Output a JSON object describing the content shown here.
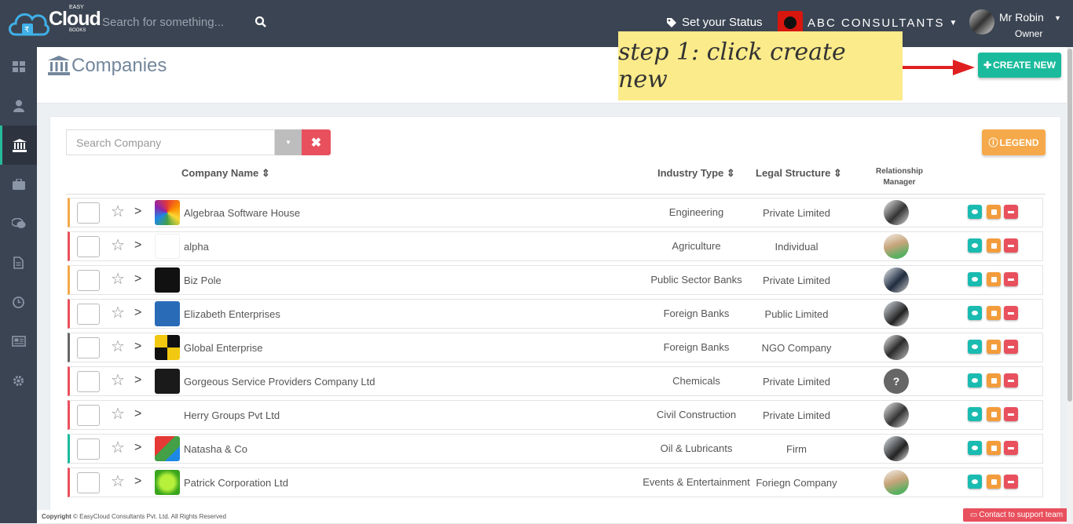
{
  "brand": {
    "name": "Cloud",
    "top": "EASY",
    "bottom": "BOOKS"
  },
  "topbar": {
    "search_placeholder": "Search for something...",
    "status_label": "Set your Status",
    "company_name": "ABC CONSULTANTS",
    "user_name": "Mr Robin",
    "user_role": "Owner"
  },
  "sidebar": {
    "items": [
      {
        "icon": "dashboard-icon",
        "active": false
      },
      {
        "icon": "user-icon",
        "active": false
      },
      {
        "icon": "bank-icon",
        "active": true
      },
      {
        "icon": "briefcase-icon",
        "active": false
      },
      {
        "icon": "chat-icon",
        "active": false
      },
      {
        "icon": "document-icon",
        "active": false
      },
      {
        "icon": "clock-icon",
        "active": false
      },
      {
        "icon": "newspaper-icon",
        "active": false
      },
      {
        "icon": "gear-icon",
        "active": false
      }
    ]
  },
  "page": {
    "title": "Companies",
    "create_label": "CREATE NEW",
    "annotation": "step 1: click create new"
  },
  "filters": {
    "search_placeholder": "Search Company",
    "legend_label": "LEGEND"
  },
  "table": {
    "headers": {
      "company": "Company Name",
      "industry": "Industry Type",
      "legal": "Legal Structure",
      "manager_line1": "Relationship",
      "manager_line2": "Manager"
    },
    "rows": [
      {
        "name": "Algebraa Software House",
        "industry": "Engineering",
        "legal": "Private Limited",
        "stripe": "#f5a94a",
        "manager": "photo-a"
      },
      {
        "name": "alpha",
        "industry": "Agriculture",
        "legal": "Individual",
        "stripe": "#e9505d",
        "manager": "photo-b"
      },
      {
        "name": "Biz Pole",
        "industry": "Public Sector Banks",
        "legal": "Private Limited",
        "stripe": "#f5a94a",
        "manager": "photo-c"
      },
      {
        "name": "Elizabeth Enterprises",
        "industry": "Foreign Banks",
        "legal": "Public Limited",
        "stripe": "#e9505d",
        "manager": "photo-d"
      },
      {
        "name": "Global Enterprise",
        "industry": "Foreign Banks",
        "legal": "NGO Company",
        "stripe": "#666666",
        "manager": "photo-e"
      },
      {
        "name": "Gorgeous Service Providers Company Ltd",
        "industry": "Chemicals",
        "legal": "Private Limited",
        "stripe": "#e9505d",
        "manager": "unknown"
      },
      {
        "name": "Herry Groups Pvt Ltd",
        "industry": "Civil Construction",
        "legal": "Private Limited",
        "stripe": "#e9505d",
        "manager": "photo-a"
      },
      {
        "name": "Natasha & Co",
        "industry": "Oil & Lubricants",
        "legal": "Firm",
        "stripe": "#1abb9c",
        "manager": "photo-d"
      },
      {
        "name": "Patrick Corporation Ltd",
        "industry": "Events & Entertainment",
        "legal": "Foriegn Company",
        "stripe": "#e9505d",
        "manager": "photo-b"
      }
    ]
  },
  "footer": {
    "copyright_bold": "Copyright",
    "copyright_rest": "© EasyCloud Consultants Pvt. Ltd. All Rights Reserved",
    "support_label": "Contact to support team"
  },
  "colors": {
    "accent": "#1abb9c",
    "danger": "#e9505d",
    "warning": "#f5a94a",
    "nav": "#3b4452"
  }
}
